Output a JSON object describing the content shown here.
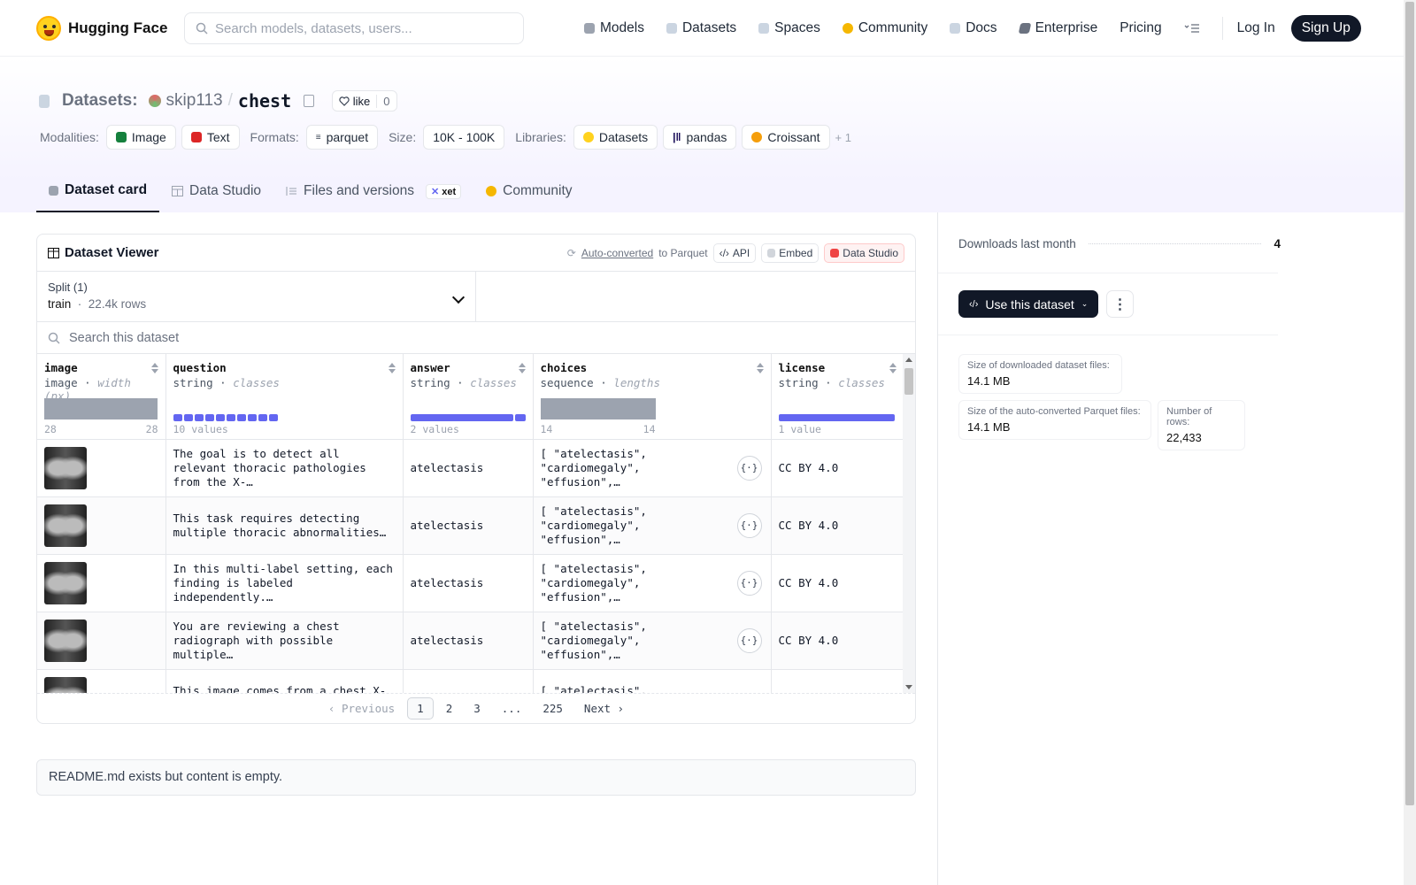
{
  "nav": {
    "logo_text": "Hugging Face",
    "search_placeholder": "Search models, datasets, users...",
    "links": [
      {
        "label": "Models",
        "icon": "cube-icon",
        "color": "#9ca3af"
      },
      {
        "label": "Datasets",
        "icon": "database-icon",
        "color": "#9ca3af"
      },
      {
        "label": "Spaces",
        "icon": "grid-icon",
        "color": "#9ca3af"
      },
      {
        "label": "Community",
        "icon": "community-icon",
        "color": "#f5b700"
      },
      {
        "label": "Docs",
        "icon": "book-icon",
        "color": "#9ca3af"
      },
      {
        "label": "Enterprise",
        "icon": "enterprise-icon",
        "color": "#6b7280"
      },
      {
        "label": "Pricing",
        "icon": "",
        "color": ""
      }
    ],
    "login": "Log In",
    "signup": "Sign Up"
  },
  "header": {
    "prefix": "Datasets:",
    "owner": "skip113",
    "slash": "/",
    "name": "chest",
    "like_label": "like",
    "like_count": "0",
    "modalities_label": "Modalities:",
    "modalities": [
      {
        "label": "Image",
        "color": "#15803d"
      },
      {
        "label": "Text",
        "color": "#dc2626"
      }
    ],
    "formats_label": "Formats:",
    "format": "parquet",
    "size_label": "Size:",
    "size": "10K - 100K",
    "libraries_label": "Libraries:",
    "libraries": [
      "Datasets",
      "pandas",
      "Croissant"
    ],
    "libraries_more": "+ 1"
  },
  "tabs": [
    {
      "label": "Dataset card",
      "icon": "cube-icon"
    },
    {
      "label": "Data Studio",
      "icon": "table-icon"
    },
    {
      "label": "Files and versions",
      "icon": "files-icon",
      "badge": "xet"
    },
    {
      "label": "Community",
      "icon": "community-icon"
    }
  ],
  "viewer": {
    "title": "Dataset Viewer",
    "autoconverted": "Auto-converted",
    "to_parquet": "to Parquet",
    "api": "API",
    "embed": "Embed",
    "data_studio": "Data Studio",
    "split_label": "Split (1)",
    "split_value": "train",
    "split_rows": "22.4k rows",
    "search_placeholder": "Search this dataset",
    "columns": [
      {
        "name": "image",
        "type": "image",
        "stat": "width (px)",
        "min": "28",
        "max": "28",
        "summary": ""
      },
      {
        "name": "question",
        "type": "string",
        "stat": "classes",
        "min": "",
        "max": "",
        "summary": "10 values"
      },
      {
        "name": "answer",
        "type": "string",
        "stat": "classes",
        "min": "",
        "max": "",
        "summary": "2 values"
      },
      {
        "name": "choices",
        "type": "sequence",
        "stat": "lengths",
        "min": "14",
        "max": "14",
        "summary": ""
      },
      {
        "name": "license",
        "type": "string",
        "stat": "classes",
        "min": "",
        "max": "",
        "summary": "1 value"
      }
    ],
    "rows": [
      {
        "question": "The goal is to detect all relevant thoracic pathologies from the X-…",
        "answer": "atelectasis",
        "choices": "[ \"atelectasis\", \"cardiomegaly\", \"effusion\",…",
        "license": "CC BY 4.0"
      },
      {
        "question": "This task requires detecting multiple thoracic abnormalities…",
        "answer": "atelectasis",
        "choices": "[ \"atelectasis\", \"cardiomegaly\", \"effusion\",…",
        "license": "CC BY 4.0"
      },
      {
        "question": "In this multi-label setting, each finding is labeled independently.…",
        "answer": "atelectasis",
        "choices": "[ \"atelectasis\", \"cardiomegaly\", \"effusion\",…",
        "license": "CC BY 4.0"
      },
      {
        "question": "You are reviewing a chest radiograph with possible multiple…",
        "answer": "atelectasis",
        "choices": "[ \"atelectasis\", \"cardiomegaly\", \"effusion\",…",
        "license": "CC BY 4.0"
      },
      {
        "question": "This image comes from a chest X-ray…",
        "answer": "",
        "choices": "[ \"atelectasis\",",
        "license": ""
      }
    ],
    "pager": {
      "prev": "Previous",
      "pages": [
        "1",
        "2",
        "3",
        "...",
        "225"
      ],
      "next": "Next"
    }
  },
  "readme_text": "README.md exists but content is empty.",
  "sidebar": {
    "downloads_label": "Downloads last month",
    "downloads_value": "4",
    "use_button": "Use this dataset",
    "stats": [
      {
        "label": "Size of downloaded dataset files:",
        "value": "14.1 MB"
      },
      {
        "label": "Size of the auto-converted Parquet files:",
        "value": "14.1 MB"
      },
      {
        "label": "Number of rows:",
        "value": "22,433"
      }
    ]
  }
}
